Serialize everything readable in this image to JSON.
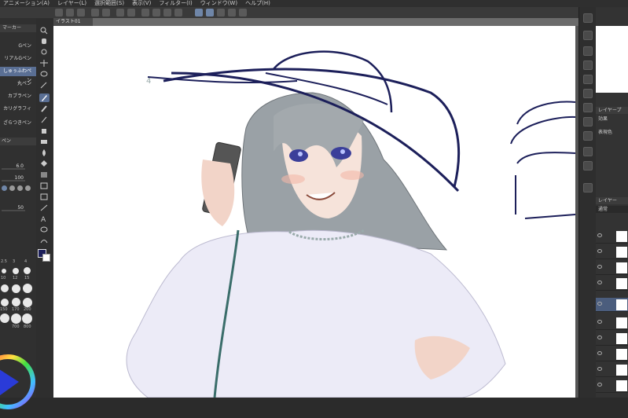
{
  "menu": {
    "items": [
      "アニメーション(A)",
      "レイヤー(L)",
      "選択範囲(S)",
      "表示(V)",
      "フィルター(I)",
      "ウィンドウ(W)",
      "ヘルプ(H)"
    ]
  },
  "sub_tool_panel": {
    "title": "マーカー",
    "brushes": [
      "Gペン",
      "リアルGペン",
      "しゅぅふわペン",
      "丸ペン",
      "カブラペン",
      "カリグラフィ",
      "ざらつきペン"
    ],
    "selected_brush_index": 2
  },
  "tool_property": {
    "title": "ペン",
    "size_value": "6.0",
    "opacity_value": "100",
    "extra_value": "50"
  },
  "brush_size_presets": {
    "labels": [
      "2.5",
      "3",
      "4",
      "10",
      "12",
      "15",
      "150",
      "170",
      "200",
      "700",
      "800"
    ]
  },
  "document": {
    "tab_label": "イラスト01"
  },
  "layer_panel": {
    "property_title": "レイヤープ",
    "effect_label": "効果",
    "expression_color_label": "表現色",
    "layer_title": "レイヤー",
    "blend_mode": "通常",
    "selected_layer_index": 4
  },
  "colors": {
    "main_color": "#1c1f5a",
    "sub_color": "#ffffff",
    "accent_selected": "#5a6f94"
  }
}
